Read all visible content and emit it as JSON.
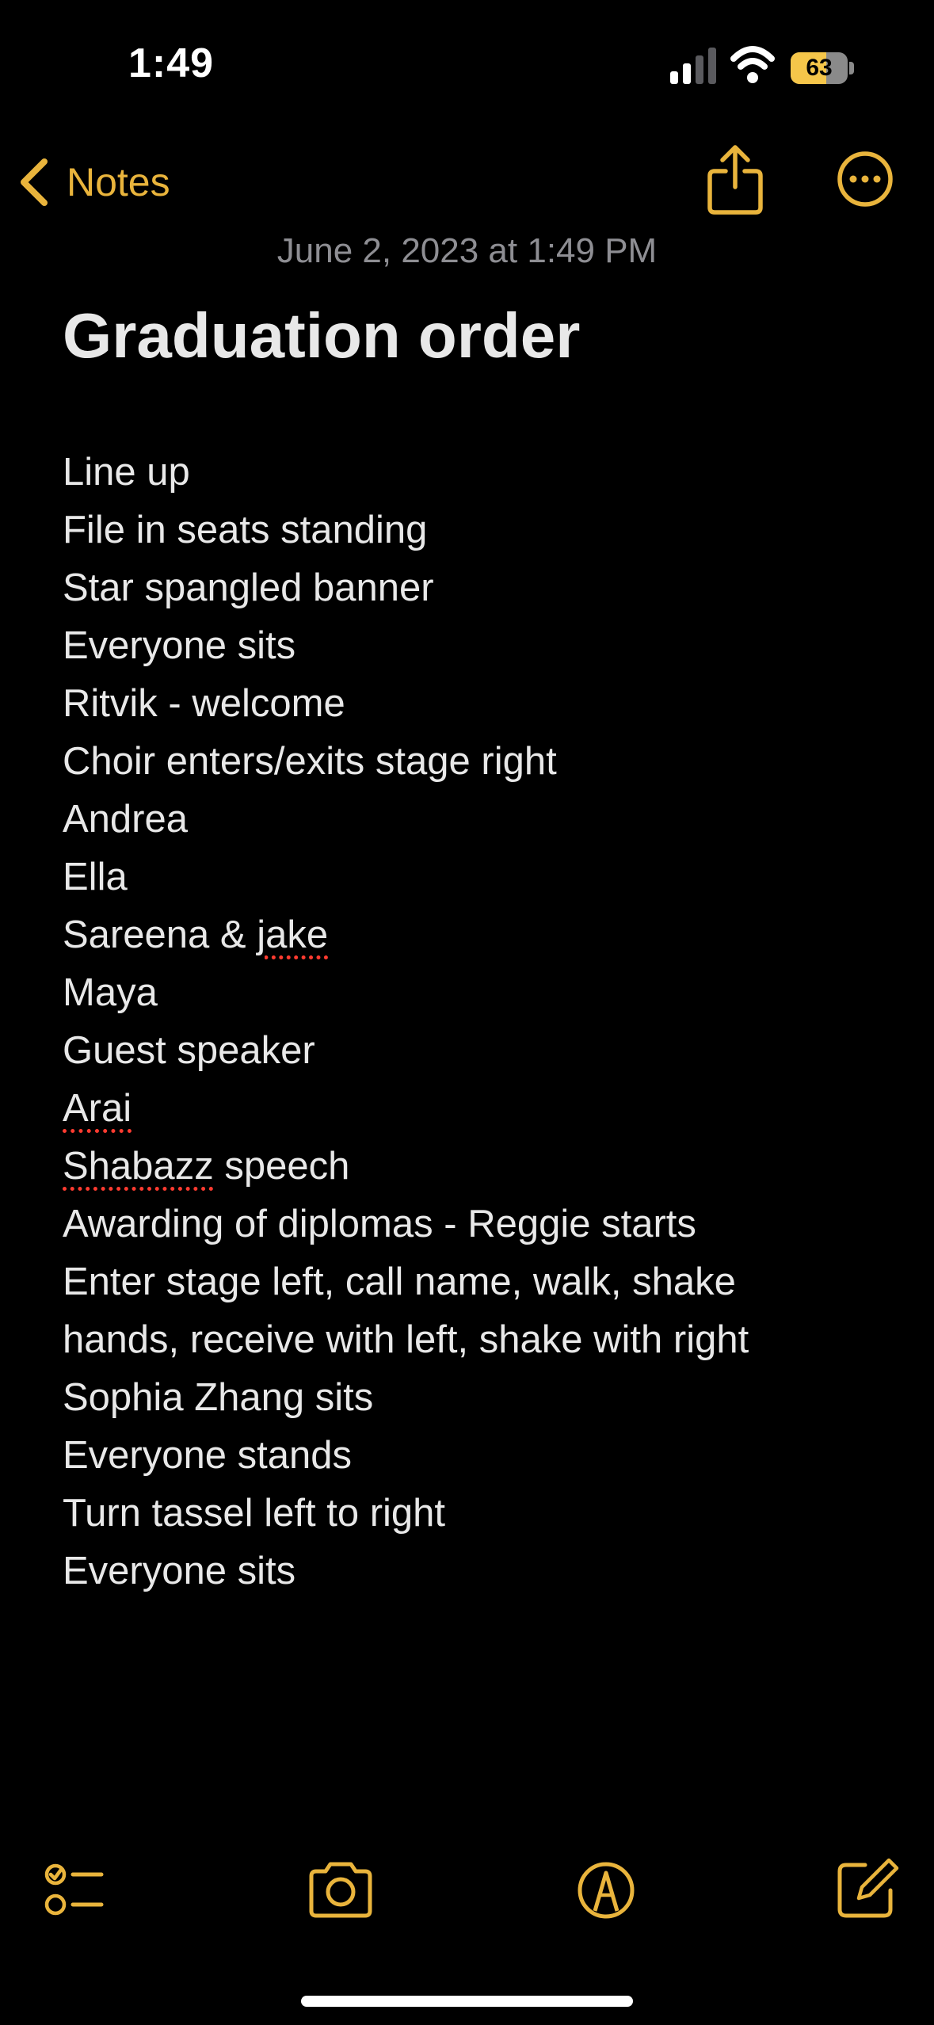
{
  "status_bar": {
    "time": "1:49",
    "battery_level": "63",
    "battery_fraction": 0.63
  },
  "nav": {
    "back_label": "Notes",
    "back_icon": "chevron-left-icon",
    "share_icon": "share-icon",
    "more_icon": "ellipsis-circle-icon"
  },
  "note": {
    "date": "June 2, 2023 at 1:49 PM",
    "title": "Graduation order",
    "lines": [
      "Line up",
      "File in seats standing",
      "Star spangled banner",
      "Everyone sits",
      "Ritvik - welcome",
      "Choir enters/exits stage right",
      "Andrea",
      "Ella",
      "Sareena & jake",
      "Maya",
      "Guest speaker",
      "Arai",
      "Shabazz speech",
      "Awarding of diplomas - Reggie starts",
      "Enter stage left, call name, walk, shake",
      "hands, receive with left, shake with right",
      "Sophia Zhang sits",
      "Everyone stands",
      "Turn tassel left to right",
      "Everyone sits"
    ],
    "misspelled_words": [
      "jake",
      "Arai",
      "Shabazz"
    ]
  },
  "toolbar": {
    "icons": [
      "checklist-icon",
      "camera-icon",
      "markup-icon",
      "compose-icon"
    ]
  },
  "colors": {
    "accent": "#e9b43c",
    "background": "#000000",
    "text": "#e8e8e8",
    "secondary": "#8e8e93",
    "spellcheck": "#ff3b30"
  }
}
